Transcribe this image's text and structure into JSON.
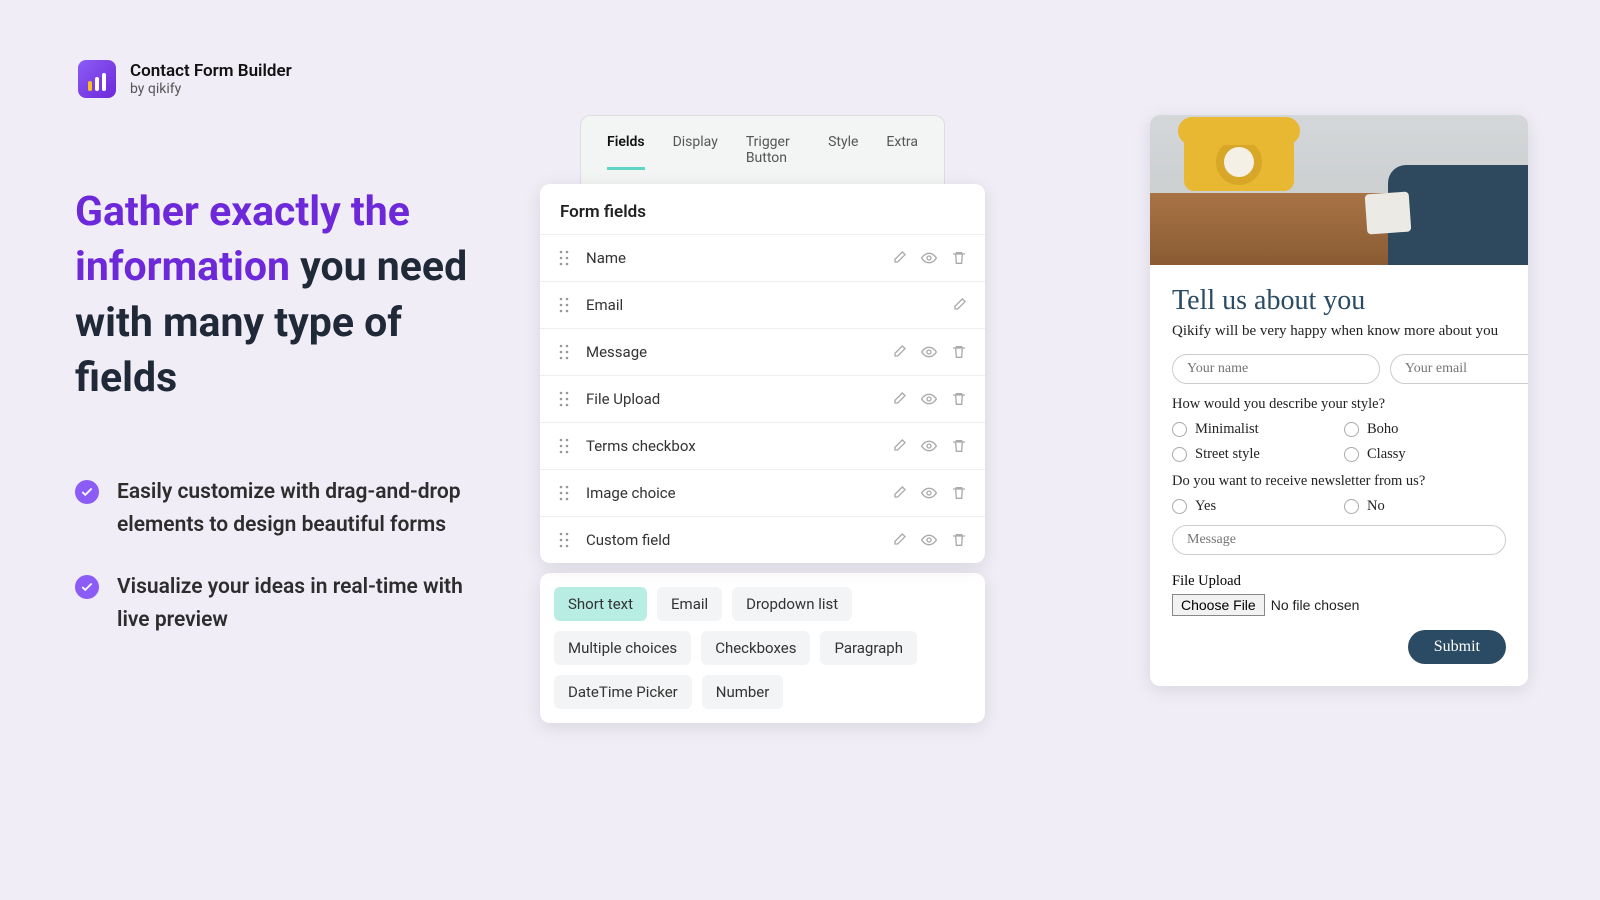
{
  "app": {
    "name": "Contact Form Builder",
    "by": "by qikify"
  },
  "hero": {
    "em": "Gather exactly the information",
    "rest": " you need with many type of fields",
    "bullets": [
      "Easily customize with drag-and-drop elements to design beautiful forms",
      "Visualize your ideas in real-time with live preview"
    ]
  },
  "builder": {
    "tabs": [
      "Fields",
      "Display",
      "Trigger Button",
      "Style",
      "Extra"
    ],
    "active_tab": 0,
    "section_title": "Form fields",
    "fields": [
      {
        "label": "Name",
        "icons": [
          "edit",
          "eye",
          "trash"
        ]
      },
      {
        "label": "Email",
        "icons": [
          "edit"
        ]
      },
      {
        "label": "Message",
        "icons": [
          "edit",
          "eye",
          "trash"
        ]
      },
      {
        "label": "File Upload",
        "icons": [
          "edit",
          "eye",
          "trash"
        ]
      },
      {
        "label": "Terms checkbox",
        "icons": [
          "edit",
          "eye",
          "trash"
        ]
      },
      {
        "label": "Image choice",
        "icons": [
          "edit",
          "eye",
          "trash"
        ]
      },
      {
        "label": "Custom field",
        "icons": [
          "edit",
          "eye",
          "trash"
        ]
      }
    ],
    "chips": [
      "Short text",
      "Email",
      "Dropdown list",
      "Multiple choices",
      "Checkboxes",
      "Paragraph",
      "DateTime Picker",
      "Number"
    ],
    "chip_selected": 0
  },
  "preview": {
    "title": "Tell us about you",
    "subtitle": "Qikify will be very happy when know more about you",
    "name_ph": "Your name",
    "email_ph": "Your email",
    "q_style": "How would you describe your style?",
    "styles": [
      "Minimalist",
      "Boho",
      "Street style",
      "Classy"
    ],
    "q_news": "Do you want to receive newsletter from us?",
    "news_opts": [
      "Yes",
      "No"
    ],
    "msg_ph": "Message",
    "file_label": "File Upload",
    "choose_file": "Choose File",
    "no_file": "No file chosen",
    "submit": "Submit"
  }
}
